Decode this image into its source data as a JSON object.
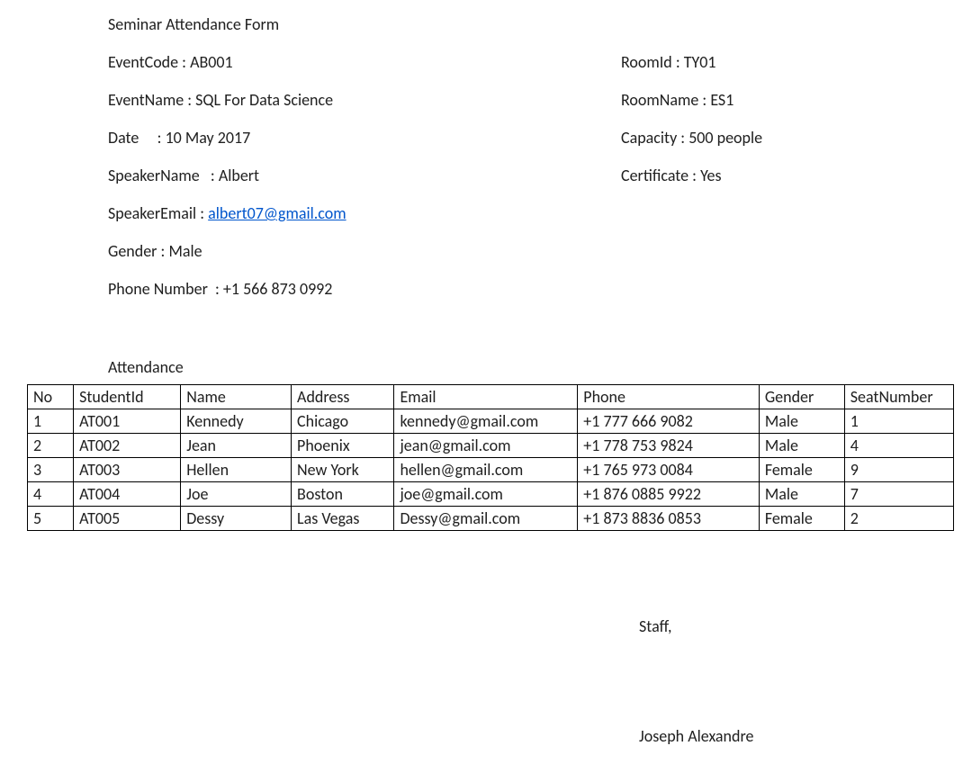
{
  "title": "Seminar Attendance Form",
  "left": {
    "eventCode": {
      "label": "EventCode",
      "sep": " : ",
      "value": "AB001"
    },
    "eventName": {
      "label": "EventName",
      "sep": " : ",
      "value": "SQL For Data Science"
    },
    "date": {
      "label": "Date",
      "sep": "     : ",
      "value": "10 May 2017"
    },
    "speakerName": {
      "label": "SpeakerName",
      "sep": "   : ",
      "value": "Albert"
    },
    "speakerEmail": {
      "label": "SpeakerEmail",
      "sep": " : ",
      "value": "albert07@gmail.com"
    },
    "gender": {
      "label": "Gender",
      "sep": " : ",
      "value": "Male"
    },
    "phone": {
      "label": "Phone Number",
      "sep": "  : ",
      "value": "+1 566 873 0992"
    }
  },
  "right": {
    "roomId": {
      "label": "RoomId",
      "sep": " : ",
      "value": "TY01"
    },
    "roomName": {
      "label": "RoomName",
      "sep": " : ",
      "value": "ES1"
    },
    "capacity": {
      "label": "Capacity",
      "sep": " : ",
      "value": "500 people"
    },
    "certificate": {
      "label": "Certificate",
      "sep": " : ",
      "value": "Yes"
    }
  },
  "attendance": {
    "heading": "Attendance",
    "headers": {
      "no": "No",
      "studentId": "StudentId",
      "name": "Name",
      "address": "Address",
      "email": "Email",
      "phone": "Phone",
      "gender": "Gender",
      "seat": "SeatNumber"
    },
    "rows": [
      {
        "no": "1",
        "studentId": "AT001",
        "name": "Kennedy",
        "address": "Chicago",
        "email": "kennedy@gmail.com",
        "phone": "+1 777 666 9082",
        "gender": "Male",
        "seat": "1"
      },
      {
        "no": "2",
        "studentId": "AT002",
        "name": "Jean",
        "address": "Phoenix",
        "email": "jean@gmail.com",
        "phone": "+1 778 753 9824",
        "gender": "Male",
        "seat": "4"
      },
      {
        "no": "3",
        "studentId": "AT003",
        "name": "Hellen",
        "address": "New York",
        "email": "hellen@gmail.com",
        "phone": "+1 765 973 0084",
        "gender": "Female",
        "seat": "9"
      },
      {
        "no": "4",
        "studentId": "AT004",
        "name": "Joe",
        "address": "Boston",
        "email": "joe@gmail.com",
        "phone": "+1 876 0885 9922",
        "gender": "Male",
        "seat": "7"
      },
      {
        "no": "5",
        "studentId": "AT005",
        "name": "Dessy",
        "address": "Las Vegas",
        "email": "Dessy@gmail.com",
        "phone": "+1 873 8836 0853",
        "gender": "Female",
        "seat": "2"
      }
    ]
  },
  "signOff": {
    "label": "Staff,",
    "name": "Joseph Alexandre"
  }
}
